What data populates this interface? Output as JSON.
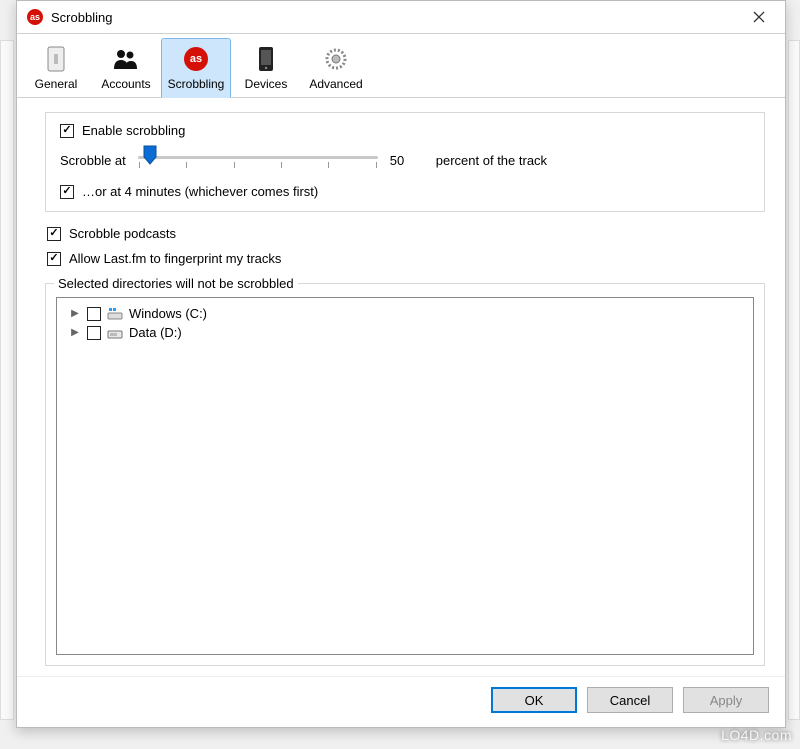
{
  "window": {
    "title": "Scrobbling"
  },
  "tabs": [
    {
      "label": "General"
    },
    {
      "label": "Accounts"
    },
    {
      "label": "Scrobbling"
    },
    {
      "label": "Devices"
    },
    {
      "label": "Advanced"
    }
  ],
  "active_tab_index": 2,
  "scrobbling": {
    "enable_label": "Enable scrobbling",
    "enable_checked": true,
    "slider_prefix": "Scrobble at",
    "slider_value": "50",
    "slider_suffix": "percent of the track",
    "or_at_label": "…or at 4 minutes (whichever comes first)",
    "or_at_checked": true
  },
  "options": {
    "podcasts_label": "Scrobble podcasts",
    "podcasts_checked": true,
    "fingerprint_label": "Allow Last.fm to fingerprint my tracks",
    "fingerprint_checked": true
  },
  "dirs": {
    "legend": "Selected directories will not be scrobbled",
    "items": [
      {
        "label": "Windows (C:)",
        "checked": false
      },
      {
        "label": "Data (D:)",
        "checked": false
      }
    ]
  },
  "buttons": {
    "ok": "OK",
    "cancel": "Cancel",
    "apply": "Apply"
  },
  "watermark": "LO4D.com"
}
